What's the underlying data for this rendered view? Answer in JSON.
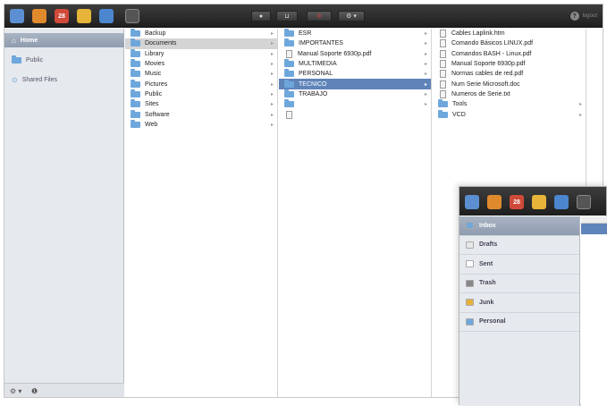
{
  "toolbar": {
    "apps": [
      {
        "name": "mail-app-icon",
        "color": "#5b8fd1",
        "label": ""
      },
      {
        "name": "notes-app-icon",
        "color": "#e08a2e",
        "label": ""
      },
      {
        "name": "calendar-app-icon",
        "color": "#d04a3a",
        "label": "28"
      },
      {
        "name": "photos-app-icon",
        "color": "#e7b43a",
        "label": ""
      },
      {
        "name": "files-app-icon",
        "color": "#4b86cf",
        "label": ""
      },
      {
        "name": "contacts-app-icon",
        "color": "#555555",
        "label": ""
      }
    ],
    "logout_label": "logout"
  },
  "sidebar": {
    "items": [
      {
        "label": "Home",
        "icon": "home-icon",
        "selected": true
      },
      {
        "label": "Public",
        "icon": "folder-icon",
        "selected": false
      },
      {
        "label": "Shared Files",
        "icon": "shared-icon",
        "selected": false
      }
    ],
    "footer": {
      "gear": "⚙ ▾",
      "info": "❶"
    }
  },
  "columns": [
    {
      "items": [
        {
          "label": "Backup",
          "type": "folder",
          "arrow": true,
          "state": ""
        },
        {
          "label": "Documents",
          "type": "folder",
          "arrow": true,
          "state": "sel"
        },
        {
          "label": "Library",
          "type": "folder",
          "arrow": true,
          "state": ""
        },
        {
          "label": "Movies",
          "type": "folder",
          "arrow": true,
          "state": ""
        },
        {
          "label": "Music",
          "type": "folder",
          "arrow": true,
          "state": ""
        },
        {
          "label": "Pictures",
          "type": "folder",
          "arrow": true,
          "state": ""
        },
        {
          "label": "Public",
          "type": "folder",
          "arrow": true,
          "state": ""
        },
        {
          "label": "Sites",
          "type": "folder",
          "arrow": true,
          "state": ""
        },
        {
          "label": "Software",
          "type": "folder",
          "arrow": true,
          "state": ""
        },
        {
          "label": "Web",
          "type": "folder",
          "arrow": true,
          "state": ""
        }
      ]
    },
    {
      "items": [
        {
          "label": "ESR",
          "type": "folder",
          "arrow": true,
          "state": ""
        },
        {
          "label": "IMPORTANTES",
          "type": "folder",
          "arrow": true,
          "state": ""
        },
        {
          "label": "Manual Soporte 6930p.pdf",
          "type": "file",
          "arrow": true,
          "state": ""
        },
        {
          "label": "MULTIMEDIA",
          "type": "folder",
          "arrow": true,
          "state": ""
        },
        {
          "label": "PERSONAL",
          "type": "folder",
          "arrow": true,
          "state": ""
        },
        {
          "label": "TECNICO",
          "type": "folder",
          "arrow": true,
          "state": "selblue"
        },
        {
          "label": "TRABAJO",
          "type": "folder",
          "arrow": true,
          "state": ""
        },
        {
          "label": "",
          "type": "folder",
          "arrow": true,
          "state": ""
        },
        {
          "label": "",
          "type": "file",
          "arrow": false,
          "state": ""
        }
      ]
    },
    {
      "items": [
        {
          "label": "Cables Laplink.htm",
          "type": "file",
          "arrow": false,
          "state": ""
        },
        {
          "label": "Comando Básicos LINUX.pdf",
          "type": "file",
          "arrow": false,
          "state": ""
        },
        {
          "label": "Comandos BASH - Linux.pdf",
          "type": "file",
          "arrow": false,
          "state": ""
        },
        {
          "label": "Manual Soporte 6930p.pdf",
          "type": "file",
          "arrow": false,
          "state": ""
        },
        {
          "label": "Normas cables de red.pdf",
          "type": "file",
          "arrow": false,
          "state": ""
        },
        {
          "label": "Num Serie Microsoft.doc",
          "type": "file",
          "arrow": false,
          "state": ""
        },
        {
          "label": "Numeros de Serie.txt",
          "type": "file",
          "arrow": false,
          "state": ""
        },
        {
          "label": "Tools",
          "type": "folder",
          "arrow": true,
          "state": ""
        },
        {
          "label": "VCD",
          "type": "folder",
          "arrow": true,
          "state": ""
        }
      ]
    }
  ],
  "mail": {
    "items": [
      {
        "label": "Inbox",
        "icon": "inbox-icon",
        "color": "#6ea7dc",
        "selected": true
      },
      {
        "label": "Drafts",
        "icon": "drafts-icon",
        "color": "#e8e8e8",
        "selected": false
      },
      {
        "label": "Sent",
        "icon": "sent-icon",
        "color": "#ffffff",
        "selected": false
      },
      {
        "label": "Trash",
        "icon": "trash-icon",
        "color": "#888888",
        "selected": false
      },
      {
        "label": "Junk",
        "icon": "junk-icon",
        "color": "#e8b13a",
        "selected": false
      },
      {
        "label": "Personal",
        "icon": "folder-icon",
        "color": "#6ea7dc",
        "selected": false
      }
    ]
  }
}
